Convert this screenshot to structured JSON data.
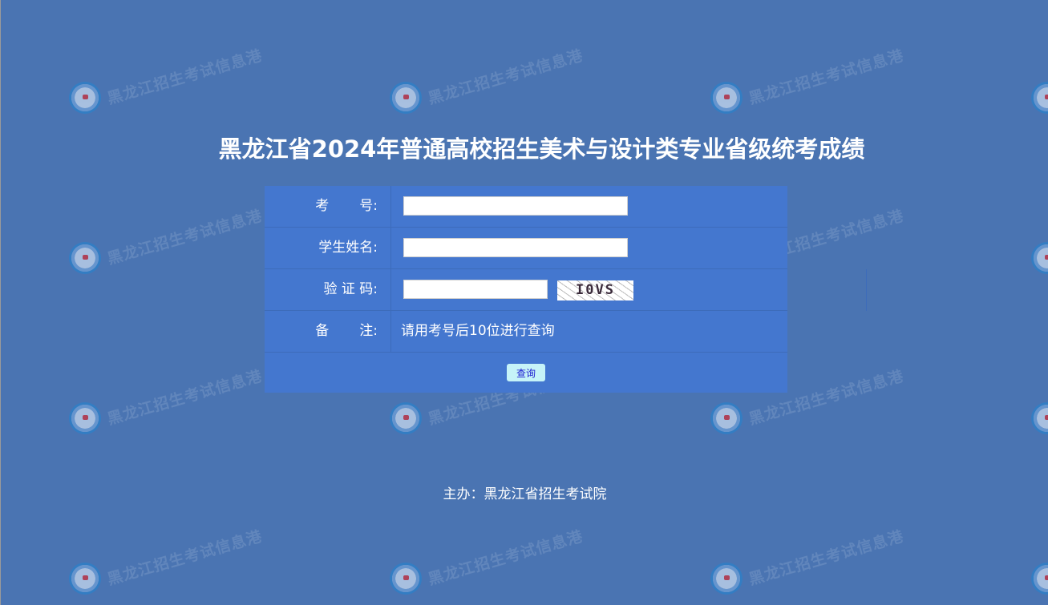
{
  "watermark": {
    "text": "黑龙江招生考试信息港"
  },
  "title": "黑龙江省2024年普通高校招生美术与设计类专业省级统考成绩",
  "form": {
    "exam_number": {
      "label_a": "考",
      "label_b": "号:",
      "value": "",
      "placeholder": ""
    },
    "student_name": {
      "label": "学生姓名:",
      "value": "",
      "placeholder": ""
    },
    "captcha": {
      "label": "验 证 码:",
      "value": "",
      "placeholder": "",
      "image_text": "I0VS"
    },
    "note": {
      "label_a": "备",
      "label_b": "注:",
      "text": "请用考号后10位进行查询"
    },
    "submit_label": "查询"
  },
  "footer": "主办：黑龙江省招生考试院"
}
